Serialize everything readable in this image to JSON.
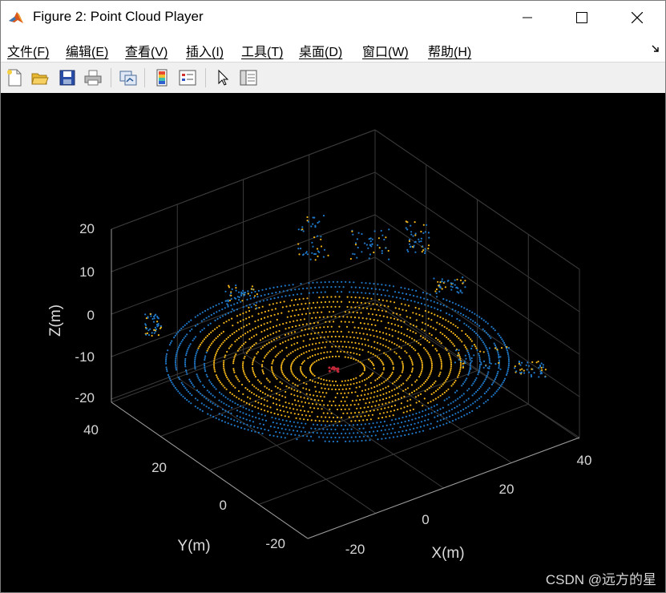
{
  "window": {
    "title": "Figure 2: Point Cloud Player",
    "app_icon": "matlab-icon",
    "controls": [
      "minimize-icon",
      "maximize-icon",
      "close-icon"
    ]
  },
  "menu": {
    "items": [
      "文件(F)",
      "编辑(E)",
      "查看(V)",
      "插入(I)",
      "工具(T)",
      "桌面(D)",
      "窗口(W)",
      "帮助(H)"
    ]
  },
  "toolbar": {
    "icons": [
      "new-figure-icon",
      "open-file-icon",
      "save-icon",
      "print-icon",
      "link-plot-icon",
      "colorbar-icon",
      "legend-icon",
      "pointer-icon",
      "property-inspector-icon"
    ]
  },
  "axes": {
    "xlabel": "X(m)",
    "ylabel": "Y(m)",
    "zlabel": "Z(m)",
    "x_ticks": [
      "-20",
      "0",
      "20",
      "40"
    ],
    "y_ticks": [
      "-20",
      "0",
      "20",
      "40"
    ],
    "z_ticks": [
      "20",
      "10",
      "0",
      "-10",
      "-20"
    ],
    "background": "#000000",
    "grid": true
  },
  "colors": {
    "near_points": "#f2b418",
    "far_points": "#1f78c8",
    "center_points": "#c02838"
  },
  "watermark": "CSDN @远方的星"
}
